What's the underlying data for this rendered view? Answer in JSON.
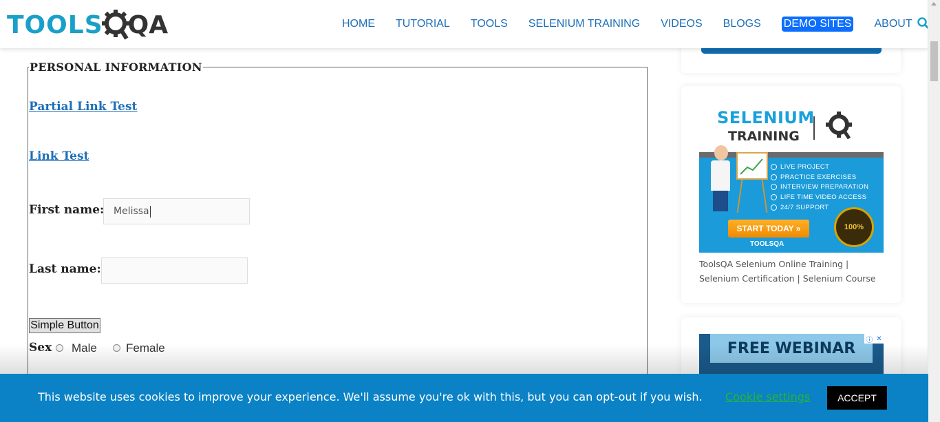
{
  "header": {
    "logo_text_a": "TOOLS",
    "logo_text_b": "QA",
    "nav": [
      "HOME",
      "TUTORIAL",
      "TOOLS",
      "SELENIUM TRAINING",
      "VIDEOS",
      "BLOGS",
      "DEMO SITES",
      "ABOUT"
    ],
    "search_icon": "search-icon"
  },
  "form": {
    "legend": "PERSONAL INFORMATION",
    "partial_link": "Partial Link Test",
    "link": "Link Test",
    "first_name_label": "First name:",
    "first_name_value": "Melissa",
    "last_name_label": "Last name:",
    "last_name_value": "",
    "simple_button": "Simple Button",
    "sex_label": "Sex",
    "male_label": "Male",
    "female_label": "Female"
  },
  "sidebar": {
    "ad1": {
      "title_a": "SELENIUM",
      "title_b": "TRAINING",
      "features": [
        "LIVE PROJECT",
        "PRACTICE EXERCISES",
        "INTERVIEW PREPARATION",
        "LIFE TIME VIDEO ACCESS",
        "24/7 SUPPORT"
      ],
      "cta": "START TODAY »",
      "footer": "TOOLSQA",
      "seal": "100%"
    },
    "caption": "ToolsQA Selenium Online Training | Selenium Certification | Selenium Course",
    "ad2": {
      "title": "FREE WEBINAR"
    }
  },
  "cookie": {
    "message": "This website uses cookies to improve your experience. We'll assume you're ok with this, but you can opt-out if you wish.",
    "settings": "Cookie settings",
    "accept": "ACCEPT"
  },
  "colors": {
    "brand": "#1aa0c8",
    "link": "#1d6fb8",
    "demo_bg": "#0d6efd",
    "cookie_bg": "#0a82c5",
    "cookie_settings": "#27b33a"
  }
}
